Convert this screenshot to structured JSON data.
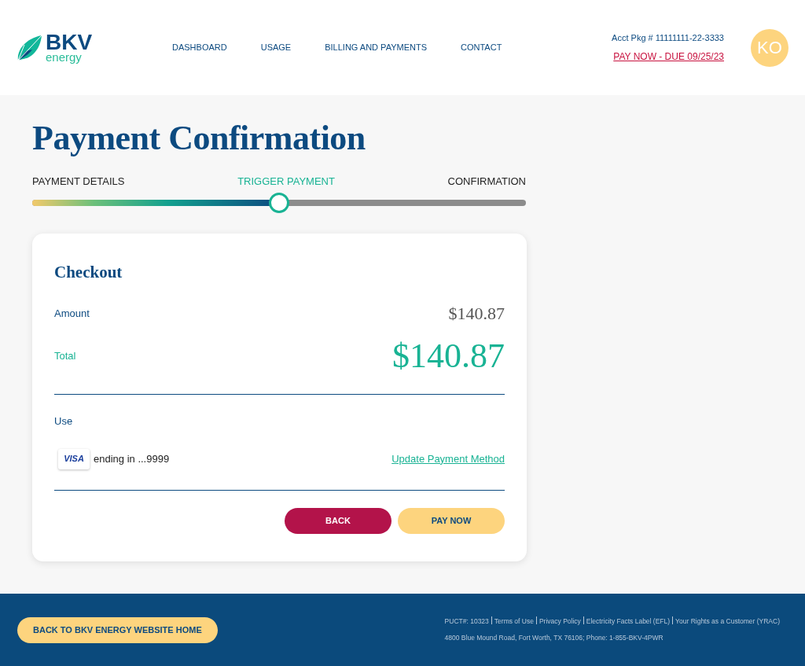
{
  "header": {
    "logo": {
      "brand": "BKV",
      "tagline": "energy"
    },
    "nav": [
      {
        "label": "DASHBOARD"
      },
      {
        "label": "USAGE"
      },
      {
        "label": "BILLING AND PAYMENTS"
      },
      {
        "label": "CONTACT"
      }
    ],
    "account": "Acct Pkg # 11111111-22-3333",
    "pay_link": "PAY NOW - DUE 09/25/23",
    "avatar": "KO"
  },
  "title": "Payment Confirmation",
  "steps": [
    {
      "label": "PAYMENT DETAILS",
      "selected": false
    },
    {
      "label": "TRIGGER PAYMENT",
      "selected": true
    },
    {
      "label": "CONFIRMATION",
      "selected": false
    }
  ],
  "progress": {
    "level": 0.5
  },
  "checkout": {
    "title": "Checkout",
    "amount_label": "Amount",
    "amount": "$140.87",
    "total_label": "Total",
    "total": "$140.87",
    "use_label": "Use",
    "card_brand": "VISA",
    "card_text": "ending in ...9999",
    "update_link": "Update Payment Method",
    "buttons": [
      {
        "label": "BACK",
        "kind": "secondary"
      },
      {
        "label": "PAY NOW",
        "kind": "primary"
      }
    ]
  },
  "footer": {
    "home_button": "BACK TO BKV ENERGY WEBSITE HOME",
    "links": [
      "PUCT#: 10323",
      "Terms of Use",
      "Privacy Policy",
      "Electricity Facts Label (EFL)",
      "Your Rights as a Customer (YRAC)"
    ],
    "address": "4800 Blue Mound Road, Fort Worth, TX 76106; Phone: 1-855-BKV-4PWR"
  }
}
